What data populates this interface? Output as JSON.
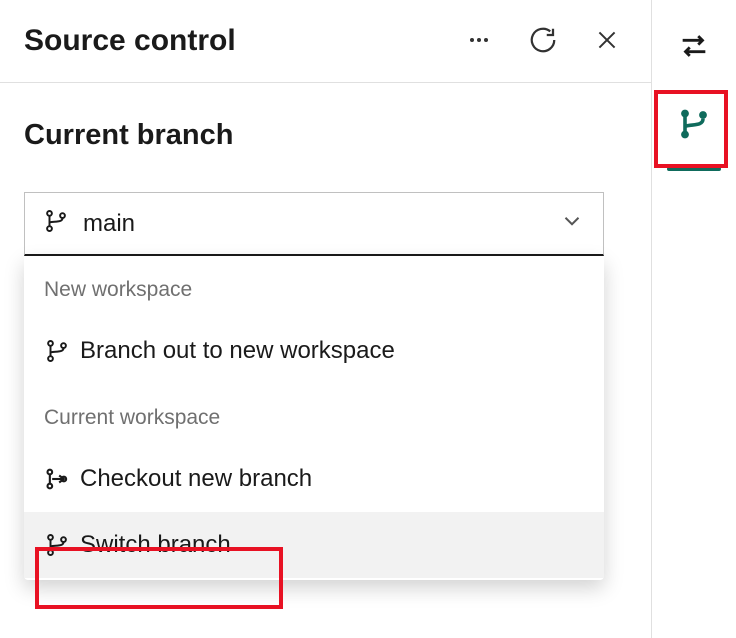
{
  "header": {
    "title": "Source control"
  },
  "section": {
    "title": "Current branch"
  },
  "dropdown": {
    "selected": "main"
  },
  "menu": {
    "heading_new": "New workspace",
    "branch_out_label": "Branch out to new workspace",
    "heading_current": "Current workspace",
    "checkout_label": "Checkout new branch",
    "switch_label": "Switch branch"
  },
  "icons": {
    "more": "more-icon",
    "refresh": "refresh-icon",
    "close": "close-icon",
    "swap": "swap-icon",
    "git": "git-branch-icon"
  },
  "colors": {
    "accent": "#0f6b5c",
    "highlight": "#e81123"
  }
}
